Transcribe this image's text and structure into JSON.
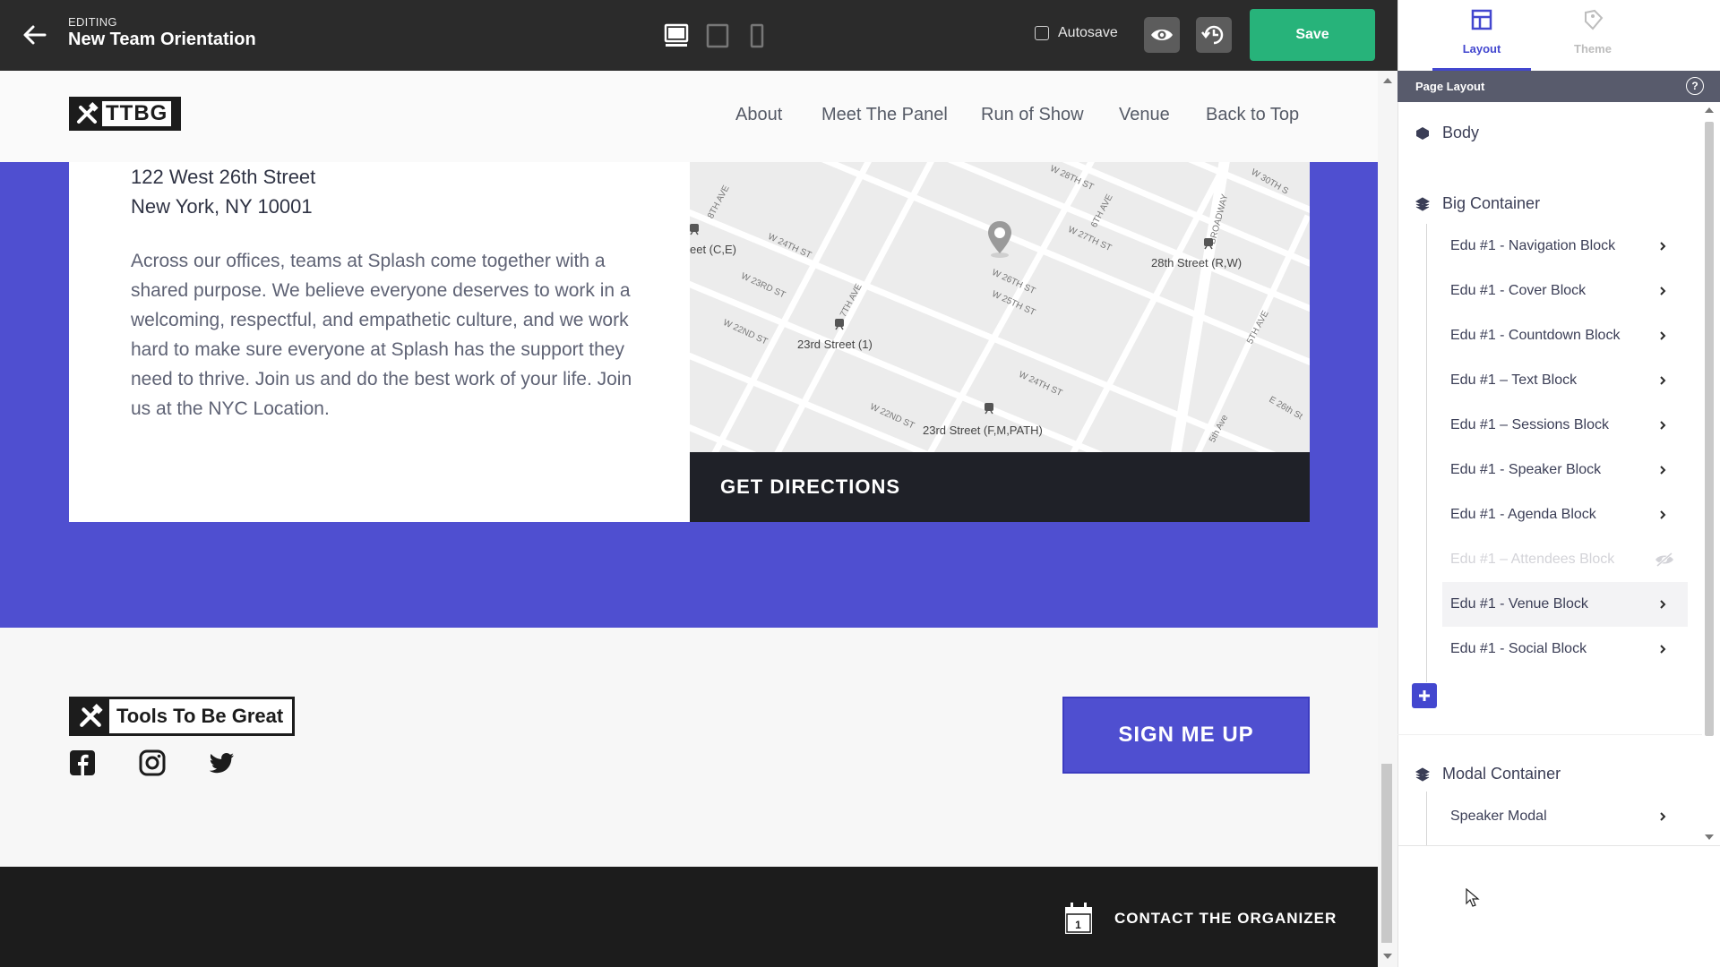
{
  "header": {
    "editing_label": "EDITING",
    "event_title": "New Team Orientation",
    "autosave_label": "Autosave",
    "save_label": "Save"
  },
  "panel": {
    "tabs": [
      {
        "label": "Layout",
        "icon": "layout-icon",
        "active": true
      },
      {
        "label": "Theme",
        "icon": "theme-icon",
        "active": false
      }
    ],
    "section_title": "Page Layout",
    "help": "?",
    "body_label": "Body",
    "big_container": {
      "label": "Big Container",
      "items": [
        {
          "label": "Edu #1 - Navigation Block"
        },
        {
          "label": "Edu #1 - Cover Block"
        },
        {
          "label": "Edu #1 - Countdown Block"
        },
        {
          "label": "Edu #1 – Text Block"
        },
        {
          "label": "Edu #1 – Sessions Block"
        },
        {
          "label": "Edu #1 - Speaker Block"
        },
        {
          "label": "Edu #1 - Agenda Block"
        },
        {
          "label": "Edu #1 – Attendees Block",
          "hidden": true
        },
        {
          "label": "Edu #1 - Venue Block",
          "selected": true
        },
        {
          "label": "Edu #1 - Social Block"
        }
      ]
    },
    "modal_container": {
      "label": "Modal Container",
      "items": [
        {
          "label": "Speaker Modal"
        }
      ]
    }
  },
  "site": {
    "logo_text": "TTBG",
    "nav": [
      "About",
      "Meet The Panel",
      "Run of Show",
      "Venue",
      "Back to Top"
    ],
    "venue": {
      "address_line1": "122 West 26th Street",
      "address_line2": "New York, NY 10001",
      "description": "Across our offices, teams at Splash come together with a shared purpose. We believe everyone deserves to work in a welcoming, respectful, and empathetic culture, and we work hard to make sure everyone at Splash has the support they need to thrive. Join us and do the best work of your life. Join us at the NYC Location.",
      "directions_label": "GET DIRECTIONS",
      "map": {
        "stations": [
          "eet (C,E)",
          "28th Street (R,W)",
          "23rd Street (1)",
          "23rd Street (F,M,PATH)"
        ],
        "streets": [
          "W 28TH ST",
          "W 27TH ST",
          "W 26TH ST",
          "W 25TH ST",
          "W 24TH ST",
          "W 24TH ST",
          "W 23RD ST",
          "W 22ND ST",
          "W 22ND ST",
          "8TH AVE",
          "7TH AVE",
          "6TH AVE",
          "BROADWAY",
          "5TH AVE",
          "E 26th St",
          "5th Ave",
          "W 30TH S"
        ]
      }
    },
    "footer": {
      "logo_text": "Tools To Be Great",
      "social": [
        "facebook-icon",
        "instagram-icon",
        "twitter-icon"
      ],
      "signup_label": "SIGN ME UP",
      "contact_label": "CONTACT THE ORGANIZER",
      "calendar_day": "1"
    }
  },
  "colors": {
    "accent": "#4f4fd0",
    "save": "#27b37a",
    "topbar": "#2b2b2b",
    "panel_accent": "#4347cf"
  }
}
